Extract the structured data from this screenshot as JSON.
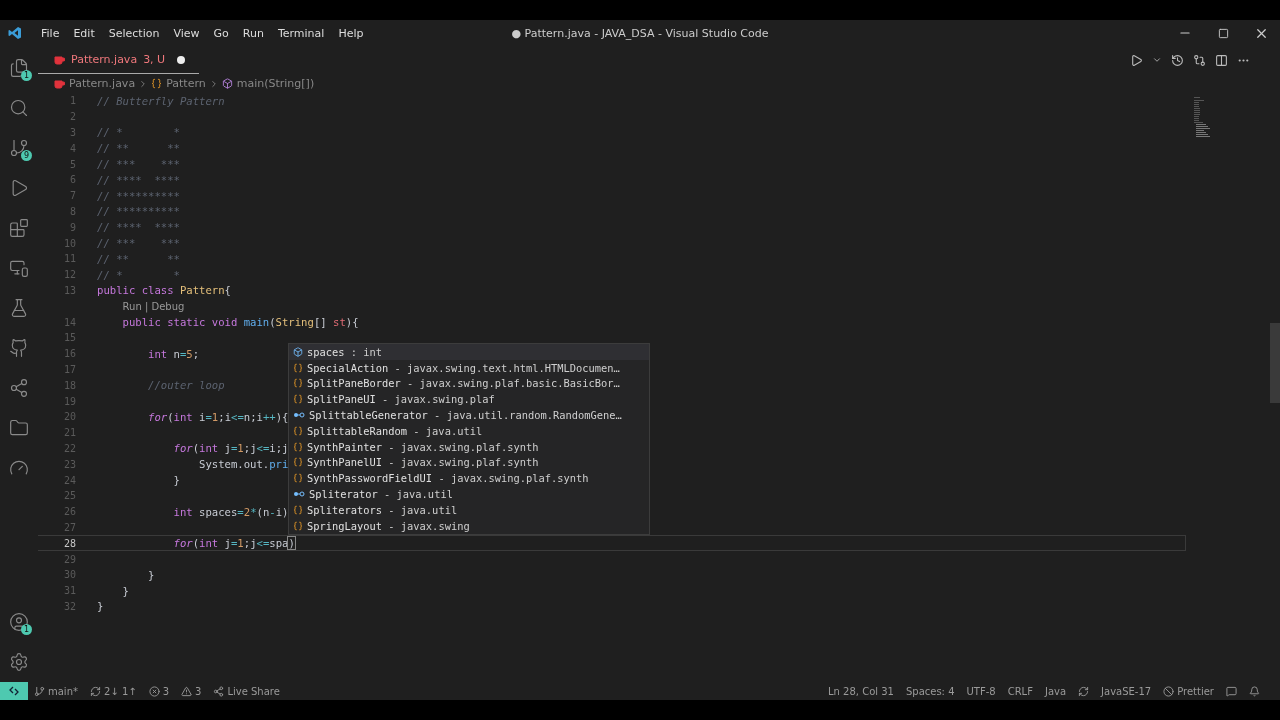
{
  "window": {
    "title": "● Pattern.java - JAVA_DSA - Visual Studio Code"
  },
  "menu": [
    "File",
    "Edit",
    "Selection",
    "View",
    "Go",
    "Run",
    "Terminal",
    "Help"
  ],
  "activity_bar": {
    "top": [
      {
        "kind": "files",
        "badge": "1"
      },
      {
        "kind": "search"
      },
      {
        "kind": "source-control",
        "badge": "9"
      },
      {
        "kind": "run"
      },
      {
        "kind": "extensions"
      },
      {
        "kind": "remote"
      },
      {
        "kind": "testing"
      },
      {
        "kind": "github"
      },
      {
        "kind": "live-share"
      },
      {
        "kind": "folder"
      },
      {
        "kind": "git-graph"
      }
    ],
    "bottom": [
      {
        "kind": "account",
        "badge": "1"
      },
      {
        "kind": "settings"
      }
    ]
  },
  "tabs": [
    {
      "label": "Pattern.java",
      "status": "3, U",
      "modified": true,
      "selected": true
    }
  ],
  "breadcrumbs": [
    {
      "kind": "file",
      "label": "Pattern.java"
    },
    {
      "kind": "class",
      "label": "Pattern"
    },
    {
      "kind": "method",
      "label": "main(String[])"
    }
  ],
  "lines": [
    {
      "kind": "code",
      "num": "1",
      "tokens": [
        {
          "text": "// Butterfly Pattern",
          "kind": "comment"
        }
      ]
    },
    {
      "kind": "code",
      "num": "2"
    },
    {
      "kind": "code",
      "num": "3",
      "tokens": [
        {
          "text": "// *        *",
          "kind": "comment"
        }
      ]
    },
    {
      "kind": "code",
      "num": "4",
      "tokens": [
        {
          "text": "// **      **",
          "kind": "comment"
        }
      ]
    },
    {
      "kind": "code",
      "num": "5",
      "tokens": [
        {
          "text": "// ***    ***",
          "kind": "comment"
        }
      ]
    },
    {
      "kind": "code",
      "num": "6",
      "tokens": [
        {
          "text": "// ****  ****",
          "kind": "comment"
        }
      ]
    },
    {
      "kind": "code",
      "num": "7",
      "tokens": [
        {
          "text": "// **********",
          "kind": "comment"
        }
      ]
    },
    {
      "kind": "code",
      "num": "8",
      "tokens": [
        {
          "text": "// **********",
          "kind": "comment"
        }
      ]
    },
    {
      "kind": "code",
      "num": "9",
      "tokens": [
        {
          "text": "// ****  ****",
          "kind": "comment"
        }
      ]
    },
    {
      "kind": "code",
      "num": "10",
      "tokens": [
        {
          "text": "// ***    ***",
          "kind": "comment"
        }
      ]
    },
    {
      "kind": "code",
      "num": "11",
      "tokens": [
        {
          "text": "// **      **",
          "kind": "comment"
        }
      ]
    },
    {
      "kind": "code",
      "num": "12",
      "tokens": [
        {
          "text": "// *        *",
          "kind": "comment"
        }
      ]
    },
    {
      "kind": "code",
      "num": "13",
      "tokens": [
        {
          "text": "public class ",
          "kind": "keyword"
        },
        {
          "text": "Pattern",
          "kind": "class"
        },
        {
          "text": "{",
          "kind": "plain"
        }
      ]
    },
    {
      "kind": "codelens",
      "text": "Run | Debug"
    },
    {
      "kind": "code",
      "num": "14",
      "tokens": [
        {
          "text": "    public static void ",
          "kind": "keyword"
        },
        {
          "text": "main",
          "kind": "function"
        },
        {
          "text": "(",
          "kind": "plain"
        },
        {
          "text": "String",
          "kind": "class"
        },
        {
          "text": "[] ",
          "kind": "plain"
        },
        {
          "text": "st",
          "kind": "param"
        },
        {
          "text": "){",
          "kind": "plain"
        }
      ]
    },
    {
      "kind": "code",
      "num": "15"
    },
    {
      "kind": "code",
      "num": "16",
      "tokens": [
        {
          "text": "        int ",
          "kind": "type"
        },
        {
          "text": "n",
          "kind": "plain"
        },
        {
          "text": "=",
          "kind": "operator"
        },
        {
          "text": "5",
          "kind": "number"
        },
        {
          "text": ";",
          "kind": "plain"
        }
      ]
    },
    {
      "kind": "code",
      "num": "17"
    },
    {
      "kind": "code",
      "num": "18",
      "tokens": [
        {
          "text": "        //outer loop",
          "kind": "comment"
        }
      ]
    },
    {
      "kind": "code",
      "num": "19"
    },
    {
      "kind": "code",
      "num": "20",
      "tokens": [
        {
          "text": "        for",
          "kind": "control"
        },
        {
          "text": "(",
          "kind": "plain"
        },
        {
          "text": "int ",
          "kind": "type"
        },
        {
          "text": "i",
          "kind": "plain"
        },
        {
          "text": "=",
          "kind": "operator"
        },
        {
          "text": "1",
          "kind": "number"
        },
        {
          "text": ";i",
          "kind": "plain"
        },
        {
          "text": "<=",
          "kind": "operator"
        },
        {
          "text": "n;i",
          "kind": "plain"
        },
        {
          "text": "++",
          "kind": "operator"
        },
        {
          "text": "){",
          "kind": "plain"
        }
      ]
    },
    {
      "kind": "code",
      "num": "21"
    },
    {
      "kind": "code",
      "num": "22",
      "tokens": [
        {
          "text": "            for",
          "kind": "control"
        },
        {
          "text": "(",
          "kind": "plain"
        },
        {
          "text": "int ",
          "kind": "type"
        },
        {
          "text": "j",
          "kind": "plain"
        },
        {
          "text": "=",
          "kind": "operator"
        },
        {
          "text": "1",
          "kind": "number"
        },
        {
          "text": ";j",
          "kind": "plain"
        },
        {
          "text": "<=",
          "kind": "operator"
        },
        {
          "text": "i;j",
          "kind": "plain"
        }
      ]
    },
    {
      "kind": "code",
      "num": "23",
      "tokens": [
        {
          "text": "                System.out.",
          "kind": "plain"
        },
        {
          "text": "pri",
          "kind": "function"
        }
      ]
    },
    {
      "kind": "code",
      "num": "24",
      "tokens": [
        {
          "text": "            }",
          "kind": "plain"
        }
      ]
    },
    {
      "kind": "code",
      "num": "25"
    },
    {
      "kind": "code",
      "num": "26",
      "tokens": [
        {
          "text": "            int ",
          "kind": "type"
        },
        {
          "text": "spaces",
          "kind": "plain"
        },
        {
          "text": "=",
          "kind": "operator"
        },
        {
          "text": "2",
          "kind": "number"
        },
        {
          "text": "*",
          "kind": "operator"
        },
        {
          "text": "(n",
          "kind": "plain"
        },
        {
          "text": "-",
          "kind": "operator"
        },
        {
          "text": "i)",
          "kind": "plain"
        }
      ]
    },
    {
      "kind": "code",
      "num": "27"
    },
    {
      "kind": "code",
      "num": "28",
      "current": true,
      "tokens": [
        {
          "text": "            for",
          "kind": "control"
        },
        {
          "text": "(",
          "kind": "plain"
        },
        {
          "text": "int ",
          "kind": "type"
        },
        {
          "text": "j",
          "kind": "plain"
        },
        {
          "text": "=",
          "kind": "operator"
        },
        {
          "text": "1",
          "kind": "number"
        },
        {
          "text": ";j",
          "kind": "plain"
        },
        {
          "text": "<=",
          "kind": "operator"
        },
        {
          "text": "spa",
          "kind": "plain"
        },
        {
          "text": ")",
          "kind": "bracket"
        }
      ]
    },
    {
      "kind": "code",
      "num": "29"
    },
    {
      "kind": "code",
      "num": "30",
      "tokens": [
        {
          "text": "        }",
          "kind": "plain"
        }
      ]
    },
    {
      "kind": "code",
      "num": "31",
      "tokens": [
        {
          "text": "    }",
          "kind": "plain"
        }
      ]
    },
    {
      "kind": "code",
      "num": "32",
      "tokens": [
        {
          "text": "}",
          "kind": "plain"
        }
      ]
    }
  ],
  "suggestions": [
    {
      "kind": "variable",
      "name": "spaces",
      "detail": " : int",
      "selected": true
    },
    {
      "kind": "class",
      "name": "SpecialAction",
      "detail": " - javax.swing.text.html.HTMLDocumen…",
      "selected": false
    },
    {
      "kind": "class",
      "name": "SplitPaneBorder",
      "detail": " - javax.swing.plaf.basic.BasicBor…",
      "selected": false
    },
    {
      "kind": "class",
      "name": "SplitPaneUI",
      "detail": " - javax.swing.plaf",
      "selected": false
    },
    {
      "kind": "interface",
      "name": "SplittableGenerator",
      "detail": " - java.util.random.RandomGene…",
      "selected": false
    },
    {
      "kind": "class",
      "name": "SplittableRandom",
      "detail": " - java.util",
      "selected": false
    },
    {
      "kind": "class",
      "name": "SynthPainter",
      "detail": " - javax.swing.plaf.synth",
      "selected": false
    },
    {
      "kind": "class",
      "name": "SynthPanelUI",
      "detail": " - javax.swing.plaf.synth",
      "selected": false
    },
    {
      "kind": "class",
      "name": "SynthPasswordFieldUI",
      "detail": " - javax.swing.plaf.synth",
      "selected": false
    },
    {
      "kind": "interface",
      "name": "Spliterator",
      "detail": " - java.util",
      "selected": false
    },
    {
      "kind": "class",
      "name": "Spliterators",
      "detail": " - java.util",
      "selected": false
    },
    {
      "kind": "class",
      "name": "SpringLayout",
      "detail": " - javax.swing",
      "selected": false
    }
  ],
  "status_bar": {
    "left": [
      {
        "kind": "branch",
        "text": "main*"
      },
      {
        "kind": "sync",
        "text": "2↓ 1↑"
      },
      {
        "kind": "errors",
        "text": "3"
      },
      {
        "kind": "warnings",
        "text": "3"
      },
      {
        "kind": "live-share",
        "text": "Live Share"
      }
    ],
    "right": [
      {
        "kind": "text",
        "text": "Ln 28, Col 31"
      },
      {
        "kind": "text",
        "text": "Spaces: 4"
      },
      {
        "kind": "text",
        "text": "UTF-8"
      },
      {
        "kind": "text",
        "text": "CRLF"
      },
      {
        "kind": "text",
        "text": "Java"
      },
      {
        "kind": "sync-icon"
      },
      {
        "kind": "text",
        "text": "JavaSE-17"
      },
      {
        "kind": "prettier",
        "text": "Prettier"
      },
      {
        "kind": "feedback-icon"
      },
      {
        "kind": "bell-icon"
      }
    ]
  }
}
